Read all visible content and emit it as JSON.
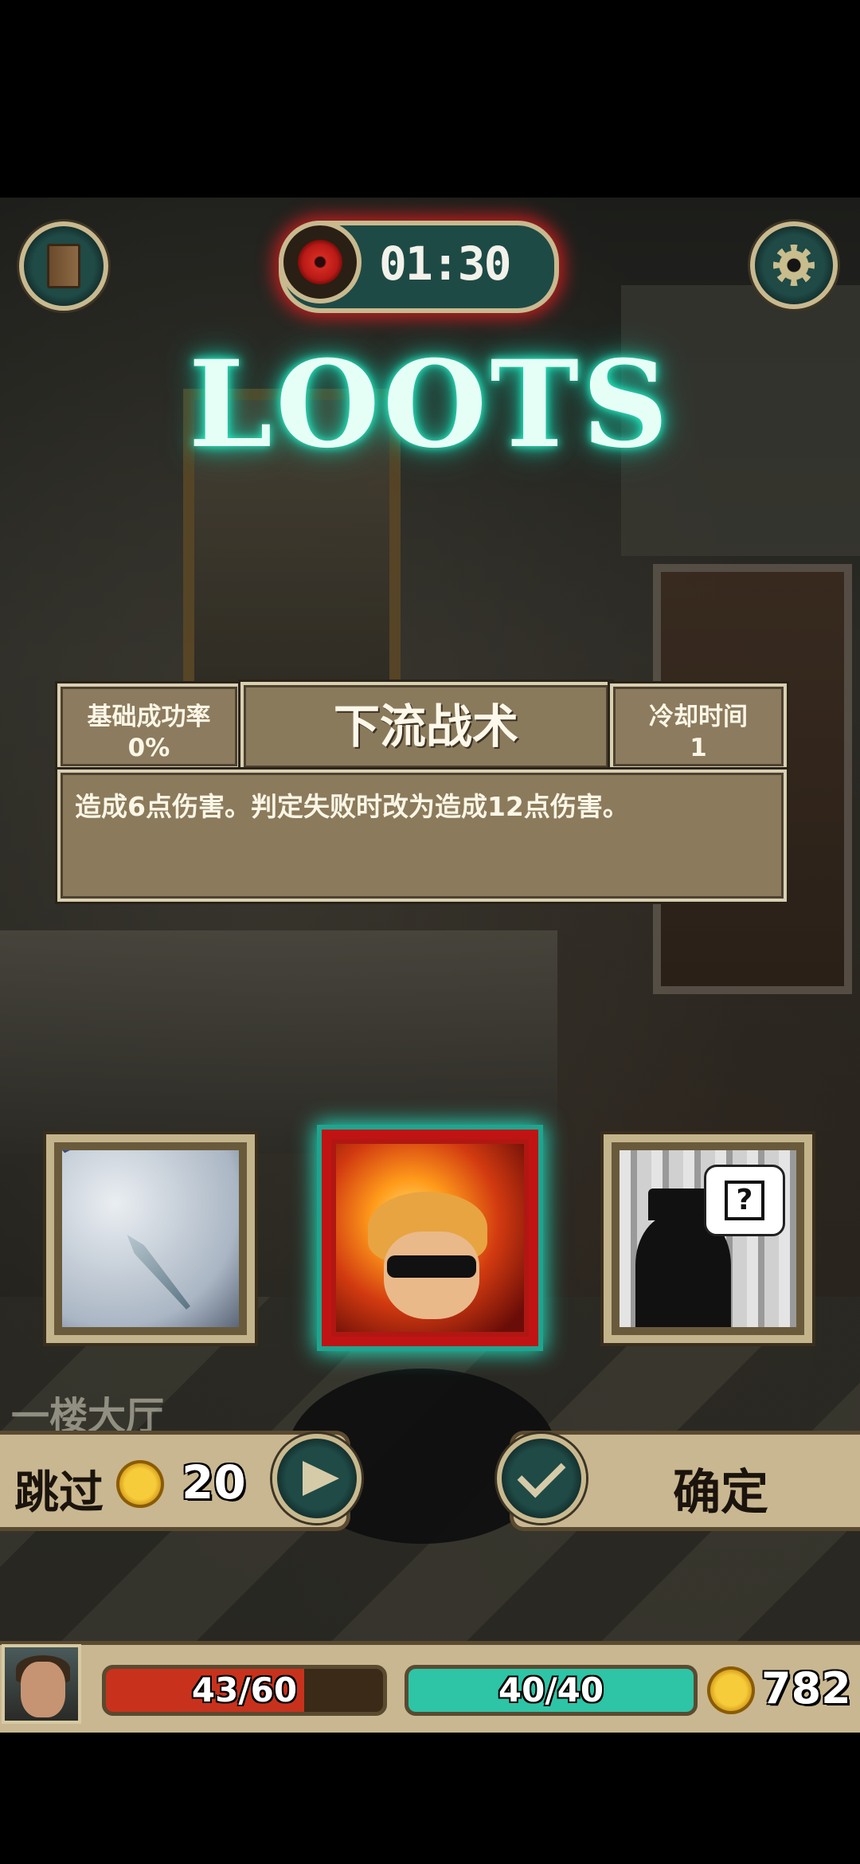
{
  "header": {
    "timer": "01:30",
    "title": "LOOTS"
  },
  "skill": {
    "base_success_label": "基础成功率",
    "base_success_value": "0%",
    "name": "下流战术",
    "cooldown_label": "冷却时间",
    "cooldown_value": "1",
    "description": "造成6点伤害。判定失败时改为造成12点伤害。"
  },
  "loots": [
    {
      "name": "clock-hand-loot",
      "selected": false
    },
    {
      "name": "dirty-tactics-loot",
      "selected": true
    },
    {
      "name": "mystery-loot",
      "selected": false
    }
  ],
  "room": {
    "label": "一楼大厅"
  },
  "actions": {
    "skip_label": "跳过",
    "skip_cost": "20",
    "confirm_label": "确定"
  },
  "status": {
    "hp_text": "43/60",
    "hp_fraction": 0.7167,
    "mp_text": "40/40",
    "mp_fraction": 1.0,
    "gold": "782"
  },
  "colors": {
    "title_glow": "#29f3c9",
    "timer_glow": "#dc1e1e",
    "selected_border": "#c01414",
    "hp": "#c8321c",
    "mp": "#2ec4a6",
    "coin": "#f7cc3b"
  },
  "icons": {
    "journal": "book-icon",
    "settings": "gear-icon",
    "timer": "eye-icon",
    "skip": "arrow-right-icon",
    "confirm": "checkmark-icon",
    "currency": "coin-icon"
  }
}
